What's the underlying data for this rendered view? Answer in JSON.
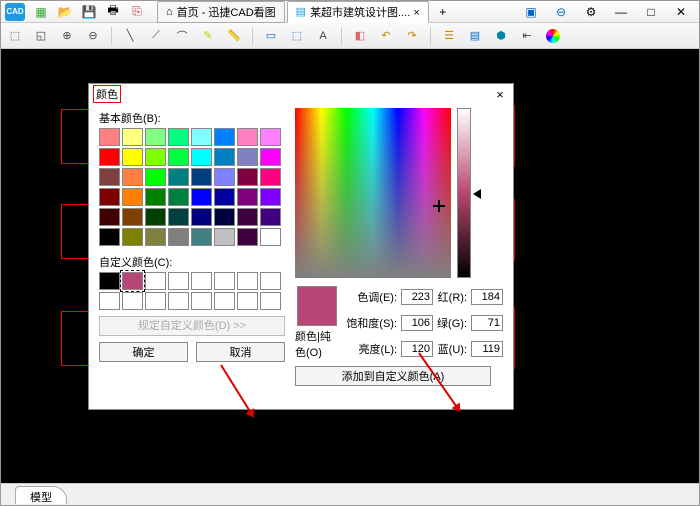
{
  "titlebar": {
    "tabs": [
      {
        "label": "首页 - 迅捷CAD看图",
        "icon": "home-icon"
      },
      {
        "label": "某超市建筑设计图.... ×",
        "icon": "file-icon",
        "active": true
      }
    ]
  },
  "statusbar": {
    "model_tab": "模型"
  },
  "dialog": {
    "title": "颜色",
    "basic_label": "基本颜色(B):",
    "custom_label": "自定义颜色(C):",
    "define_btn": "规定自定义颜色(D) >>",
    "ok": "确定",
    "cancel": "取消",
    "pure_label": "颜色|纯色(O)",
    "add_btn": "添加到自定义颜色(A)",
    "fields": {
      "hue_label": "色调(E):",
      "hue": "223",
      "sat_label": "饱和度(S):",
      "sat": "106",
      "lum_label": "亮度(L):",
      "lum": "120",
      "r_label": "红(R):",
      "r": "184",
      "g_label": "绿(G):",
      "g": "71",
      "b_label": "蓝(U):",
      "b": "119"
    },
    "preview_color": "#b84777",
    "basic_colors": [
      "#ff8080",
      "#ffff80",
      "#80ff80",
      "#00ff80",
      "#80ffff",
      "#0080ff",
      "#ff80c0",
      "#ff80ff",
      "#ff0000",
      "#ffff00",
      "#80ff00",
      "#00ff40",
      "#00ffff",
      "#0080c0",
      "#8080c0",
      "#ff00ff",
      "#804040",
      "#ff8040",
      "#00ff00",
      "#008080",
      "#004080",
      "#8080ff",
      "#800040",
      "#ff0080",
      "#800000",
      "#ff8000",
      "#008000",
      "#008040",
      "#0000ff",
      "#0000a0",
      "#800080",
      "#8000ff",
      "#400000",
      "#804000",
      "#004000",
      "#004040",
      "#000080",
      "#000040",
      "#400040",
      "#400080",
      "#000000",
      "#808000",
      "#808040",
      "#808080",
      "#408080",
      "#c0c0c0",
      "#400040",
      "#ffffff"
    ],
    "custom_colors": [
      "#000000",
      "#b84777",
      "#ffffff",
      "#ffffff",
      "#ffffff",
      "#ffffff",
      "#ffffff",
      "#ffffff",
      "#ffffff",
      "#ffffff",
      "#ffffff",
      "#ffffff",
      "#ffffff",
      "#ffffff",
      "#ffffff",
      "#ffffff"
    ]
  }
}
